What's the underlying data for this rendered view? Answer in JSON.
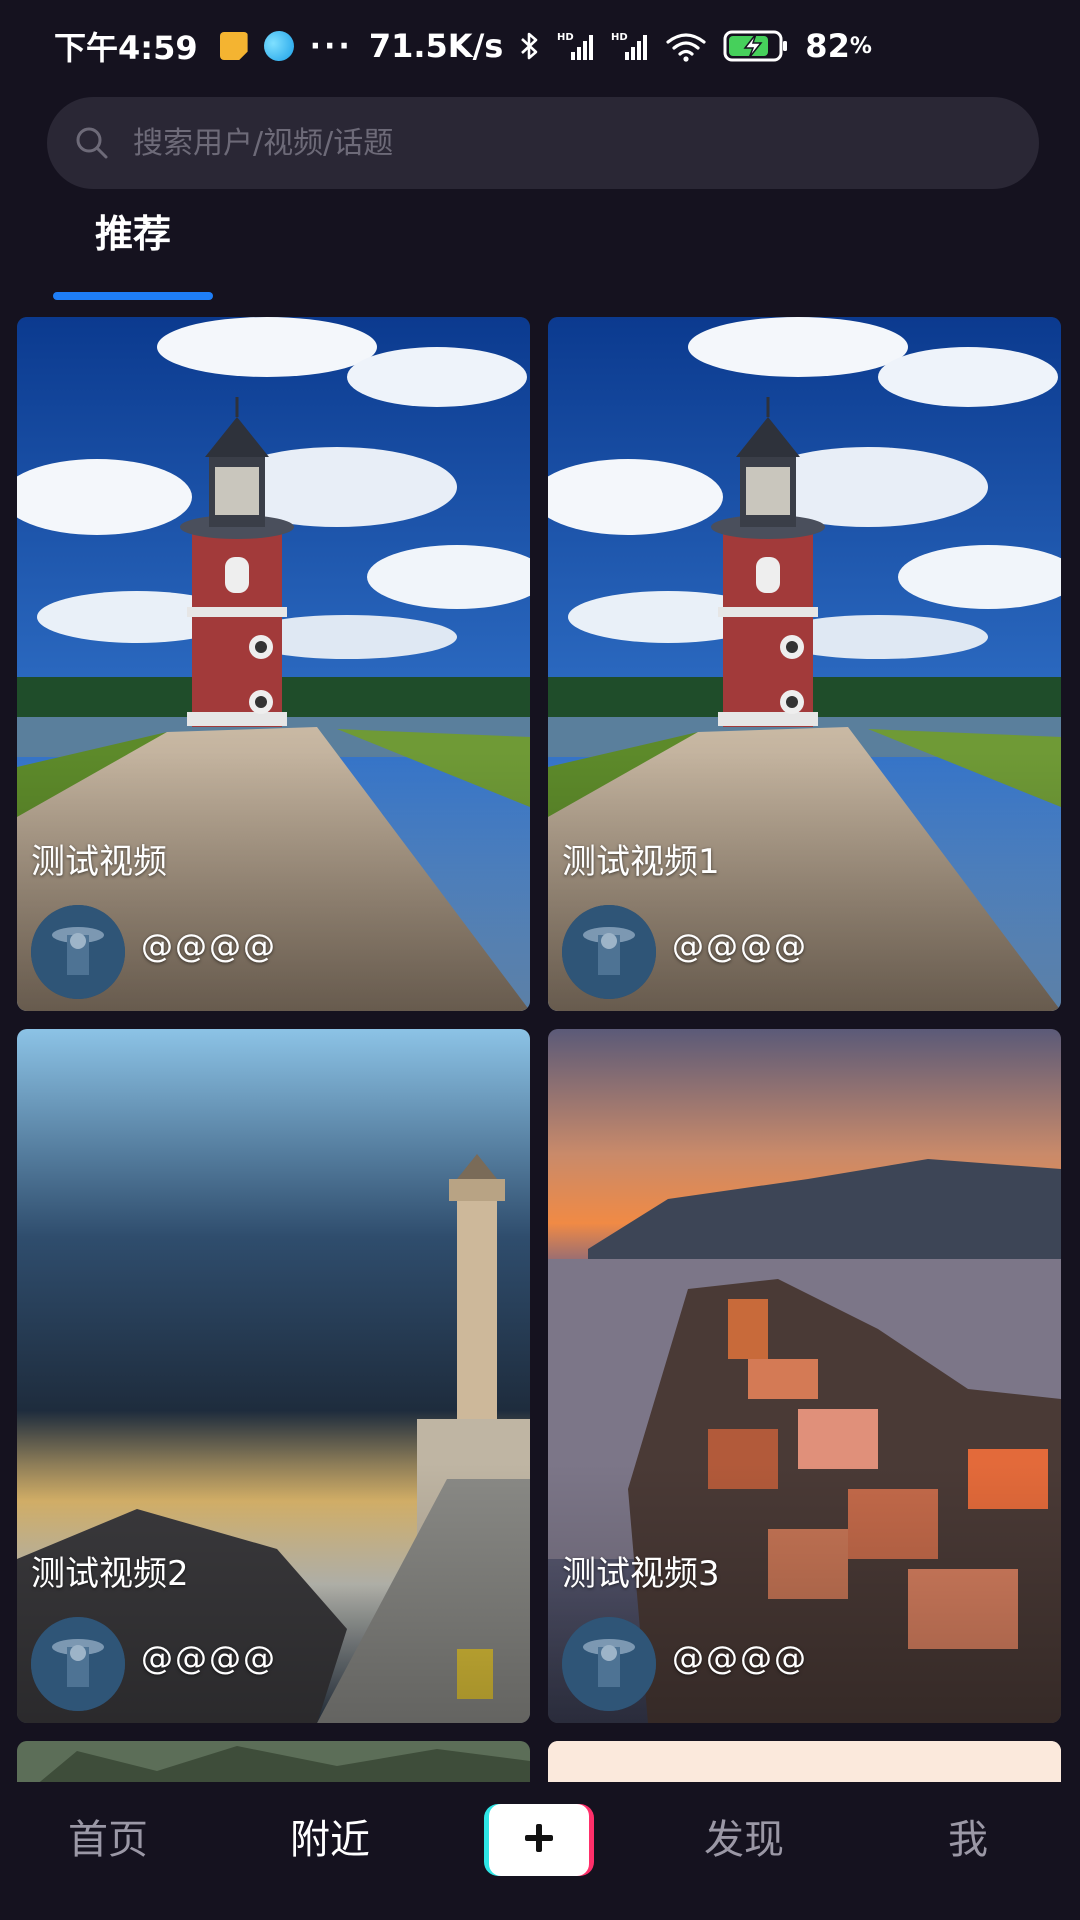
{
  "status_bar": {
    "time": "下午4:59",
    "more": "···",
    "net_speed": "71.5K/s",
    "battery_percent": "82",
    "battery_unit": "%",
    "battery_level": 0.82,
    "icons": [
      "note-icon",
      "app-bubble-icon",
      "bluetooth-icon",
      "hd-signal-icon",
      "hd-signal-icon",
      "wifi-icon",
      "battery-charging-icon"
    ]
  },
  "search": {
    "placeholder": "搜索用户/视频/话题",
    "value": "",
    "icon": "search-icon"
  },
  "tabs": [
    {
      "label": "推荐",
      "active": true
    }
  ],
  "colors": {
    "background": "#15121f",
    "search_bg": "#2a2735",
    "tab_indicator": "#1e7ef7",
    "nav_inactive": "#9b98a6",
    "nav_active": "#ffffff",
    "add_cyan": "#2ee6e6",
    "add_pink": "#ff2f6a"
  },
  "videos": [
    {
      "title": "测试视频",
      "user": "@@@@",
      "thumbnail": "lighthouse-red-brick"
    },
    {
      "title": "测试视频1",
      "user": "@@@@",
      "thumbnail": "lighthouse-red-brick"
    },
    {
      "title": "测试视频2",
      "user": "@@@@",
      "thumbnail": "lighthouse-stone-fog"
    },
    {
      "title": "测试视频3",
      "user": "@@@@",
      "thumbnail": "coastal-village-sunset"
    }
  ],
  "bottom_nav": {
    "home": "首页",
    "nearby": "附近",
    "add": "+",
    "discover": "发现",
    "me": "我",
    "active": "nearby"
  }
}
